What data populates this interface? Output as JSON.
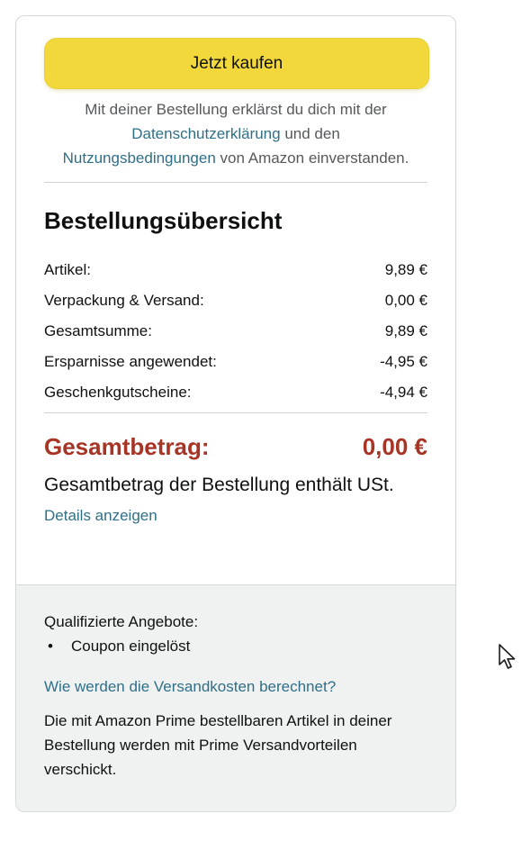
{
  "buy_button": {
    "label": "Jetzt kaufen"
  },
  "legal": {
    "prefix": "Mit deiner Bestellung erklärst du dich mit der",
    "privacy_link": "Datenschutzerklärung",
    "and": "und den",
    "terms_link": "Nutzungsbedingungen",
    "suffix": "von Amazon einverstanden."
  },
  "summary": {
    "title": "Bestellungsübersicht",
    "rows": [
      {
        "label": "Artikel:",
        "value": "9,89 €"
      },
      {
        "label": "Verpackung & Versand:",
        "value": "0,00 €"
      },
      {
        "label": "Gesamtsumme:",
        "value": "9,89 €"
      },
      {
        "label": "Ersparnisse angewendet:",
        "value": "-4,95 €"
      },
      {
        "label": "Geschenkgutscheine:",
        "value": "-4,94 €"
      }
    ],
    "total_label": "Gesamtbetrag:",
    "total_value": "0,00 €",
    "vat_text": "Gesamtbetrag der Bestellung enthält USt.",
    "details_link": "Details anzeigen"
  },
  "offers": {
    "title": "Qualifizierte Angebote:",
    "items": [
      "Coupon eingelöst"
    ]
  },
  "shipping": {
    "link": "Wie werden die Versandkosten berechnet?",
    "text": "Die mit Amazon Prime bestellbaren Artikel in deiner Bestellung werden mit Prime Versandvorteilen verschickt."
  },
  "colors": {
    "button": "#f2d83a",
    "link": "#2f6f87",
    "total": "#a73425",
    "panel": "#f0f2f2"
  },
  "icons": {
    "cursor": "mouse-pointer-icon"
  }
}
